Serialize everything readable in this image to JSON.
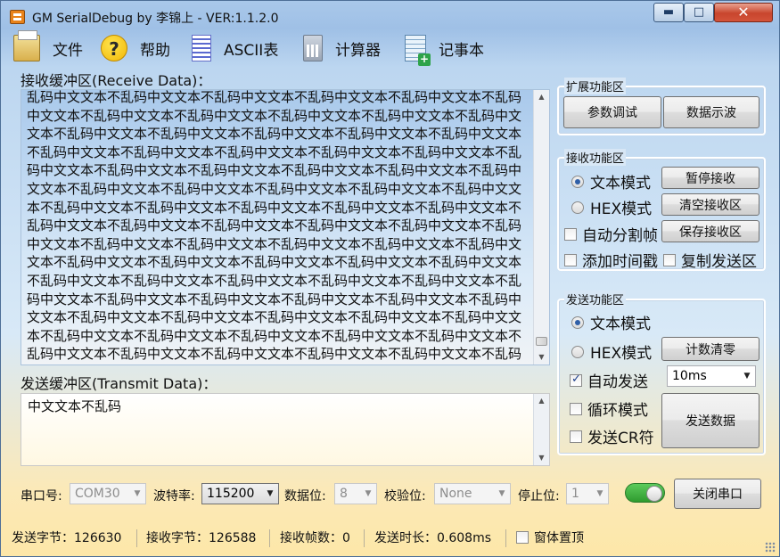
{
  "window": {
    "title": "GM SerialDebug by 李锦上 - VER:1.1.2.0",
    "minimize_glyph": "▬",
    "maximize_glyph": "□",
    "close_glyph": "✕"
  },
  "menu": {
    "items": [
      {
        "label": "文件",
        "icon": "folder-icon"
      },
      {
        "label": "帮助",
        "icon": "help-icon"
      },
      {
        "label": "ASCII表",
        "icon": "ascii-table-icon"
      },
      {
        "label": "计算器",
        "icon": "calculator-icon"
      },
      {
        "label": "记事本",
        "icon": "notepad-icon"
      }
    ],
    "help_glyph": "?"
  },
  "receive": {
    "label": "接收缓冲区(Receive Data)：",
    "content": "乱码中文文本不乱码中文文本不乱码中文文本不乱码中文文本不乱码中文文本不乱码中文文本不乱码中文文本不乱码中文文本不乱码中文文本不乱码中文文本不乱码中文文本不乱码中文文本不乱码中文文本不乱码中文文本不乱码中文文本不乱码中文文本不乱码中文文本不乱码中文文本不乱码中文文本不乱码中文文本不乱码中文文本不乱码中文文本不乱码中文文本不乱码中文文本不乱码中文文本不乱码中文文本不乱码中文文本不乱码中文文本不乱码中文文本不乱码中文文本不乱码中文文本不乱码中文文本不乱码中文文本不乱码中文文本不乱码中文文本不乱码中文文本不乱码中文文本不乱码中文文本不乱码中文文本不乱码中文文本不乱码中文文本不乱码中文文本不乱码中文文本不乱码中文文本不乱码中文文本不乱码中文文本不乱码中文文本不乱码中文文本不乱码中文文本不乱码中文文本不乱码中文文本不乱码中文文本不乱码中文文本不乱码中文文本不乱码中文文本不乱码中文文本不乱码中文文本不乱码中文文本不乱码中文文本不乱码中文文本不乱码中文文本不乱码中文文本不乱码中文文本不乱码中文文本不乱码中文文本不乱码中文文本不乱码中文文本不乱码中文文本不乱码中文文本不乱码中文文本不乱码中文文本不乱码中文文本不乱码中文文本不乱码中文文本不乱码中文文本不乱码中文文本不乱码中文文本不乱码中文文本不乱码中文文本不乱码中文文本不乱码中文文本不乱码中文文本不乱码中文文本不乱码中文文本不乱码中文文本不乱码中文文本不乱码中文文本不乱码中文文本不乱码中文文本不乱码中文文本不乱码中文文本不乱码中文文本不乱码中文文本不乱码中文文本不乱码中文文本不乱码中文文本不乱码中文文本不乱码中文文本不乱码中文文本不乱码中文文本不乱码中文文本不乱码中文文本不乱码中文文本不乱码"
  },
  "transmit": {
    "label": "发送缓冲区(Transmit Data)：",
    "content": "中文文本不乱码"
  },
  "expand_group": {
    "title": "扩展功能区",
    "param_debug": "参数调试",
    "data_scope": "数据示波"
  },
  "receive_group": {
    "title": "接收功能区",
    "text_mode": "文本模式",
    "hex_mode": "HEX模式",
    "auto_split": "自动分割帧",
    "add_timestamp": "添加时间戳",
    "pause_receive": "暂停接收",
    "clear_receive": "清空接收区",
    "save_receive": "保存接收区",
    "copy_send": "复制发送区"
  },
  "send_group": {
    "title": "发送功能区",
    "text_mode": "文本模式",
    "hex_mode": "HEX模式",
    "reset_count": "计数清零",
    "auto_send": "自动发送",
    "auto_send_interval": "10ms",
    "loop_mode": "循环模式",
    "send_cr": "发送CR符",
    "send_data": "发送数据"
  },
  "port": {
    "port_label": "串口号:",
    "port_value": "COM30",
    "baud_label": "波特率:",
    "baud_value": "115200",
    "databits_label": "数据位:",
    "databits_value": "8",
    "parity_label": "校验位:",
    "parity_value": "None",
    "stopbits_label": "停止位:",
    "stopbits_value": "1",
    "close_port": "关闭串口"
  },
  "status": {
    "sent_bytes": "发送字节：126630",
    "recv_bytes": "接收字节：126588",
    "recv_frames": "接收帧数：0",
    "send_duration": "发送时长：0.608ms",
    "window_topmost": "窗体置顶"
  },
  "state": {
    "recv_text_mode": true,
    "send_text_mode": true,
    "auto_send_checked": true,
    "port_toggle_on": true
  },
  "colors": {
    "toggle_on": "#3aa83a",
    "close_button": "#c8452d"
  }
}
